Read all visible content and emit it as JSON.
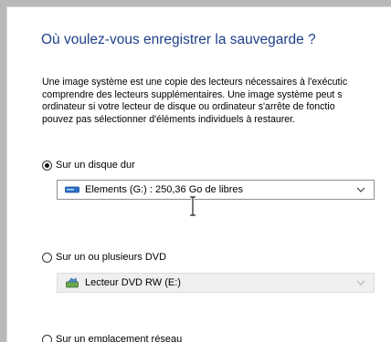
{
  "dialog": {
    "heading": "Où voulez-vous enregistrer la sauvegarde ?",
    "description_lines": [
      "Une image système est une copie des lecteurs nécessaires à l'exécutic",
      "comprendre des lecteurs supplémentaires. Une image système peut s",
      "ordinateur si votre lecteur de disque ou ordinateur s'arrête de fonctio",
      "pouvez pas sélectionner d'éléments individuels à restaurer."
    ]
  },
  "options": {
    "hard_disk": {
      "label": "Sur un disque dur",
      "selected": true,
      "dropdown_value": "Elements (G:) : 250,36 Go de libres",
      "dropdown_icon": "drive-icon",
      "enabled": true
    },
    "dvd": {
      "label": "Sur un ou plusieurs DVD",
      "selected": false,
      "dropdown_value": "Lecteur DVD RW (E:)",
      "dropdown_icon": "dvd-drive-icon",
      "enabled": false
    },
    "network": {
      "label": "Sur un emplacement réseau",
      "selected": false
    }
  },
  "colors": {
    "heading": "#1e3f8a",
    "drive_icon_blue": "#2a6fc9"
  }
}
